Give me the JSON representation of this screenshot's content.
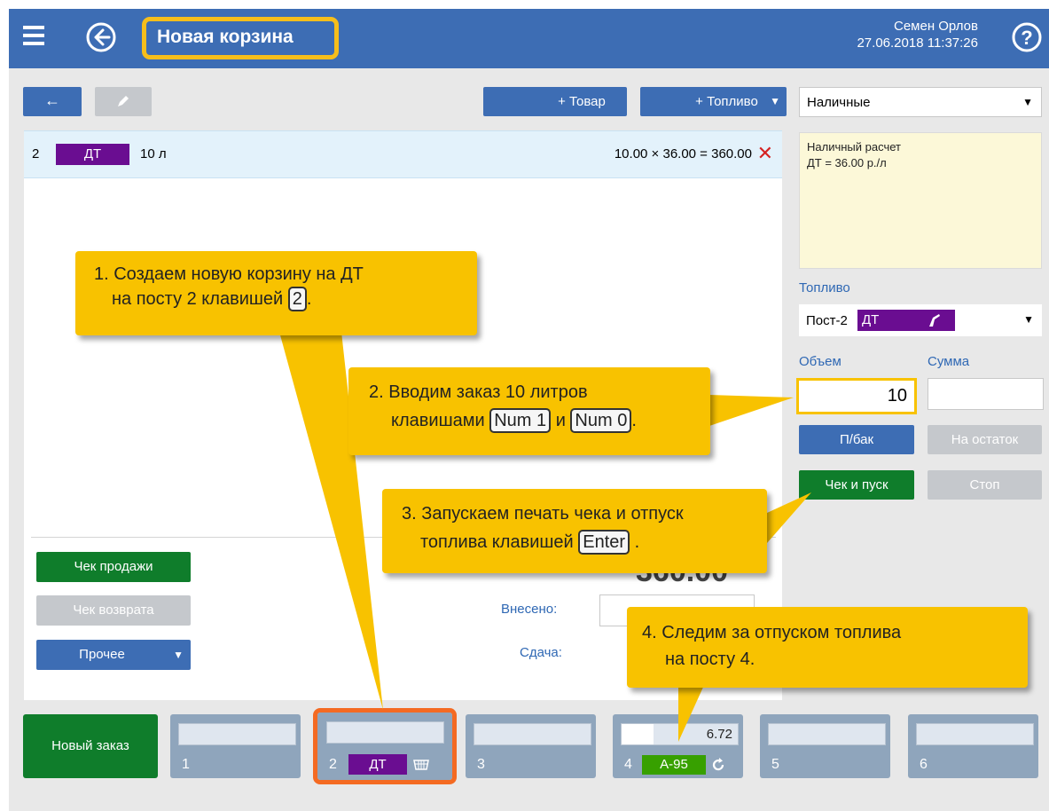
{
  "header": {
    "title": "Новая корзина",
    "user_name": "Семен Орлов",
    "datetime": "27.06.2018 11:37:26",
    "help": "?"
  },
  "toolbar": {
    "back_arrow": "←",
    "add_goods": "+ Товар",
    "add_fuel": "+ Топливо"
  },
  "order_row": {
    "post": "2",
    "fuel": "ДТ",
    "qty": "10 л",
    "formula": "10.00 × 36.00 = 360.00",
    "delete": "✕"
  },
  "actions": {
    "sale_receipt": "Чек продажи",
    "return_receipt": "Чек возврата",
    "other": "Прочее",
    "paid_label": "Внесено:",
    "change_label": "Сдача:",
    "total_fragment": "360.00"
  },
  "payment": {
    "method": "Наличные",
    "note_line1": "Наличный расчет",
    "note_line2": "ДТ = 36.00 р./л"
  },
  "fuel_panel": {
    "label": "Топливо",
    "post": "Пост-2",
    "fuel": "ДТ",
    "volume_label": "Объем",
    "sum_label": "Сумма",
    "volume_value": "10",
    "full_tank": "П/бак",
    "remainder": "На остаток",
    "check_start": "Чек и пуск",
    "stop": "Стоп"
  },
  "bottom": {
    "new_order": "Новый заказ",
    "tiles": [
      {
        "n": "1"
      },
      {
        "n": "2",
        "fuel": "ДТ"
      },
      {
        "n": "3"
      },
      {
        "n": "4",
        "fuel": "А-95",
        "value": "6.72"
      },
      {
        "n": "5"
      },
      {
        "n": "6"
      }
    ]
  },
  "callouts": {
    "c1_line1": "1. Создаем новую корзину на ДТ",
    "c1_line2": "на посту 2 клавишей",
    "c1_key": "2",
    "c1_end": ".",
    "c2_line1": "2. Вводим заказ 10 литров",
    "c2_line2": "клавишами",
    "c2_key1": "Num 1",
    "c2_and": "и",
    "c2_key2": "Num 0",
    "c2_end": ".",
    "c3_line1": "3. Запускаем печать чека и отпуск",
    "c3_line2": "топлива клавишей",
    "c3_key": "Enter",
    "c3_end": ".",
    "c4_line1": "4. Следим за отпуском топлива",
    "c4_line2": "на посту 4."
  },
  "colors": {
    "header": "#3d6db4",
    "callout": "#f8c200",
    "fuel_dt": "#6a0d91",
    "fuel_a95": "#37a000",
    "green_button": "#0f7d2b"
  }
}
